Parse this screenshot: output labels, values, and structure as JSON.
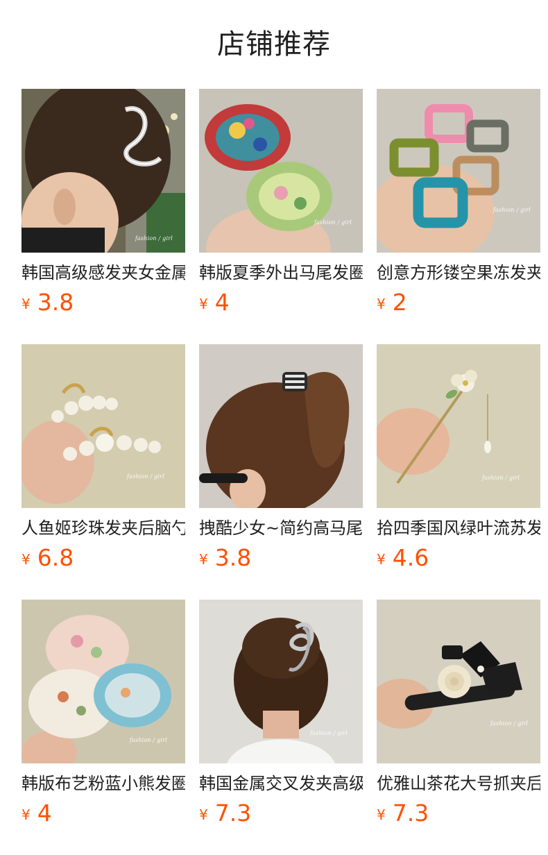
{
  "page_title": "店铺推荐",
  "currency_symbol": "¥",
  "watermark": "fashion / girl",
  "products": [
    {
      "name": "韩国高级感发夹女金属抓夹",
      "price": "3.8",
      "icon": "gold-hair-claw-photo"
    },
    {
      "name": "韩版夏季外出马尾发圈",
      "price": "4",
      "icon": "floral-scrunchie-photo"
    },
    {
      "name": "创意方形镂空果冻发夹",
      "price": "2",
      "icon": "square-jelly-claw-photo"
    },
    {
      "name": "人鱼姬珍珠发夹后脑勺",
      "price": "6.8",
      "icon": "pearl-hair-clip-photo"
    },
    {
      "name": "拽酷少女~简约高马尾抓夹",
      "price": "3.8",
      "icon": "ponytail-claw-photo"
    },
    {
      "name": "拾四季国风绿叶流苏发簪",
      "price": "4.6",
      "icon": "flower-hairpin-photo"
    },
    {
      "name": "韩版布艺粉蓝小熊发圈",
      "price": "4",
      "icon": "fabric-scrunchie-photo"
    },
    {
      "name": "韩国金属交叉发夹高级感",
      "price": "7.3",
      "icon": "metal-cross-claw-photo"
    },
    {
      "name": "优雅山茶花大号抓夹后脑勺",
      "price": "7.3",
      "icon": "camellia-bow-claw-photo"
    }
  ]
}
